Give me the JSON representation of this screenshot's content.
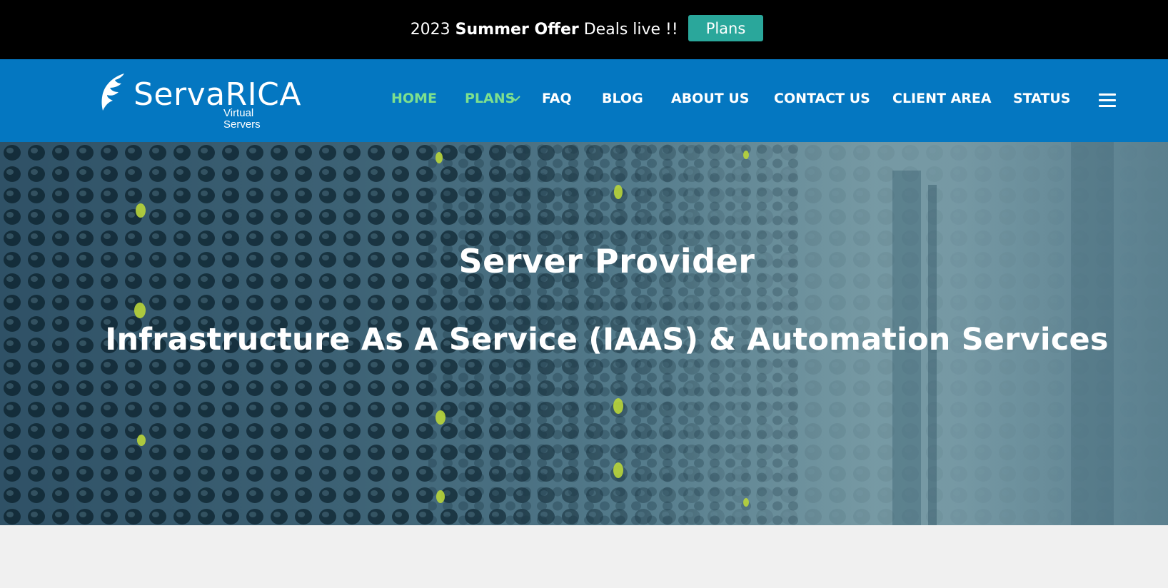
{
  "offer_bar": {
    "prefix": "2023 ",
    "highlight": "Summer Offer",
    "suffix": " Deals live !!",
    "button_label": "Plans",
    "button_color": "#2aa79b",
    "background": "#000000"
  },
  "header": {
    "background": "#0477c1",
    "logo": {
      "name": "ServaRICA",
      "tagline": "Virtual Servers"
    },
    "nav": [
      {
        "label": "HOME",
        "active": true
      },
      {
        "label": "PLANS",
        "active": true,
        "has_dropdown": true
      },
      {
        "label": "FAQ",
        "active": false
      },
      {
        "label": "BLOG",
        "active": false
      },
      {
        "label": "ABOUT US",
        "active": false
      },
      {
        "label": "CONTACT US",
        "active": false
      },
      {
        "label": "CLIENT AREA",
        "active": false
      },
      {
        "label": "STATUS",
        "active": false
      }
    ],
    "active_color": "#7ee08e",
    "menu_icon": "hamburger-icon"
  },
  "hero": {
    "title": "Server Provider",
    "subtitle": "Infrastructure As A Service (IAAS) & Automation Services"
  }
}
